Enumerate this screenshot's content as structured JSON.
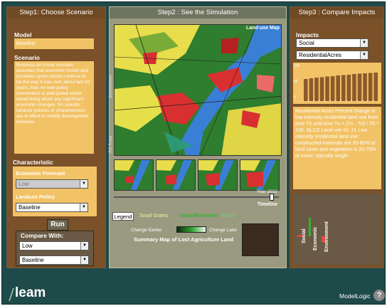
{
  "steps": {
    "step1": "Step1: Choose Scenario",
    "step2": "Step2 : See the Simulation",
    "step3": "Step3 : Compare Impacts"
  },
  "scenario_panel": {
    "model_label": "Model",
    "model_value": "Baseline",
    "scenario_label": "Scenario",
    "scenario_text": "Business as Usual scenario assumes that economic trends and business cycles would continue to be the way it was over about last 20 years. Also no new policy intervention is anticipated which would bring about any significant economic changes. No specific landuse policies or characteristics are in effect to modify development behavior.",
    "characteristic_label": "Characteristic",
    "economic_forecast_label": "Economic Forecast",
    "economic_forecast_value": "Low",
    "landuse_policy_label": "Landuse Policy",
    "landuse_policy_value": "Baseline",
    "run_label": "Run",
    "compare_with_label": "Compare With:",
    "compare_forecast_value": "Low",
    "compare_policy_value": "Baseline"
  },
  "simulation": {
    "map_title": "Land-use Map",
    "side_label_downtown": "downtown",
    "side_label_all_area": "All Area",
    "year_label": "Year 2022",
    "timeline_label": "Timeline",
    "timeline_progress": 0.97,
    "legend_tab": "Legend",
    "legend_small_grains": "Small Grains",
    "legend_urban": "Urban/Recreatio",
    "legend_more": "Resid",
    "change_earlier": "Change Earlier",
    "change_later": "Change Later",
    "summary_title": "Summary Map of Lost Agriculture Land"
  },
  "impacts": {
    "impacts_label": "Impacts",
    "impact_type_value": "Social",
    "impact_metric_value": "ResidentialAcres",
    "y_ticks": [
      "100",
      "50",
      "0"
    ],
    "bar_values": [
      0.62,
      0.64,
      0.66,
      0.67,
      0.69,
      0.7,
      0.72,
      0.73,
      0.74,
      0.76,
      0.77,
      0.78,
      0.79,
      0.8
    ],
    "description": "Residential Acres Percent change in low intensity residential land use from time T0 until time Tn = (Tn - T0) / T0 * 100. NLCD Land-use ID: 21 Low intensity residential land use: constructed materials are 30-80% of land cover and vegetation is 20-70% of cover; typically single-",
    "vertical_labels": [
      "Social",
      "Economic",
      "Environment"
    ]
  },
  "footer": {
    "logo": "leam",
    "modellogic": "ModelLogic"
  },
  "colors": {
    "panel_brown": "#7a5128",
    "field_orange": "#f2c266",
    "center_gray": "#9a9a80",
    "background": "#1f4a4a"
  }
}
